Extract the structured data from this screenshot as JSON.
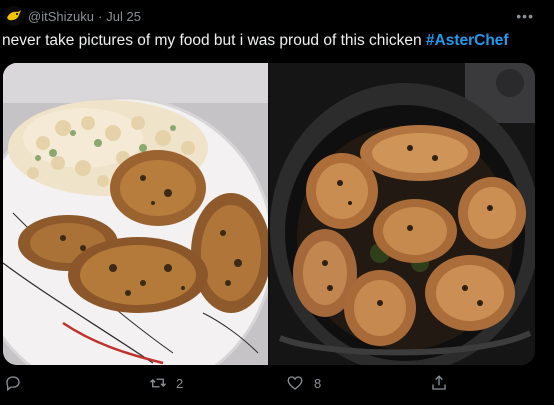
{
  "tweet": {
    "handle": "@itShizuku",
    "separator": "·",
    "date": "Jul 25",
    "more_label": "•••",
    "text": "never take pictures of my food but i was proud of this chicken ",
    "hashtag": "#AsterChef"
  },
  "actions": {
    "reply_count": "",
    "retweet_count": "2",
    "like_count": "8"
  },
  "colors": {
    "background": "#000000",
    "text": "#e7e9ea",
    "muted": "#8b9096",
    "link": "#1d9bf0"
  }
}
